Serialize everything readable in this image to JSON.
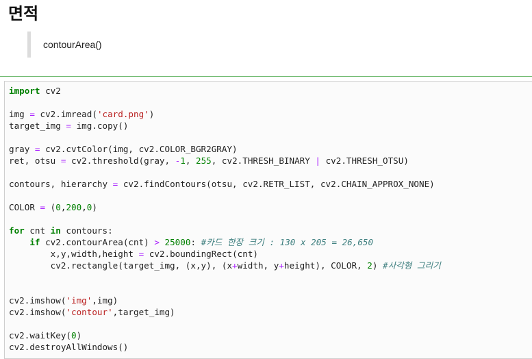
{
  "heading": "면적",
  "quote": "contourArea()",
  "code": {
    "line1": {
      "kw": "import",
      "rest": " cv2"
    },
    "line3": {
      "a": "img ",
      "op": "=",
      "b": " cv2.imread(",
      "str": "'card.png'",
      "c": ")"
    },
    "line4": {
      "a": "target_img ",
      "op": "=",
      "b": " img.copy()"
    },
    "line6": {
      "a": "gray ",
      "op": "=",
      "b": " cv2.cvtColor(img, cv2.COLOR_BGR2GRAY)"
    },
    "line7": {
      "a": "ret, otsu ",
      "op1": "=",
      "b": " cv2.threshold(gray, ",
      "op2": "-",
      "n1": "1",
      "c": ", ",
      "n2": "255",
      "d": ", cv2.THRESH_BINARY ",
      "op3": "|",
      "e": " cv2.THRESH_OTSU)"
    },
    "line9": {
      "a": "contours, hierarchy ",
      "op": "=",
      "b": " cv2.findContours(otsu, cv2.RETR_LIST, cv2.CHAIN_APPROX_NONE)"
    },
    "line11": {
      "a": "COLOR ",
      "op": "=",
      "b": " (",
      "n1": "0",
      "c1": ",",
      "n2": "200",
      "c2": ",",
      "n3": "0",
      "d": ")"
    },
    "line13": {
      "kw1": "for",
      "a": " cnt ",
      "kw2": "in",
      "b": " contours:"
    },
    "line14": {
      "indent": "    ",
      "kw": "if",
      "a": " cv2.contourArea(cnt) ",
      "op": ">",
      "b": " ",
      "n": "25000",
      "c": ": ",
      "com": "#카드 한장 크기 : 130 x 205 = 26,650"
    },
    "line15": {
      "indent": "        ",
      "a": "x,y,width,height ",
      "op": "=",
      "b": " cv2.boundingRect(cnt)"
    },
    "line16": {
      "indent": "        ",
      "a": "cv2.rectangle(target_img, (x,y), (x",
      "op1": "+",
      "b": "width, y",
      "op2": "+",
      "c": "height), COLOR, ",
      "n": "2",
      "d": ") ",
      "com": "#사각형 그리기"
    },
    "line19": {
      "a": "cv2.imshow(",
      "s1": "'img'",
      "b": ",img)"
    },
    "line20": {
      "a": "cv2.imshow(",
      "s1": "'contour'",
      "b": ",target_img)"
    },
    "line22": {
      "a": "cv2.waitKey(",
      "n": "0",
      "b": ")"
    },
    "line23": {
      "a": "cv2.destroyAllWindows()"
    }
  }
}
